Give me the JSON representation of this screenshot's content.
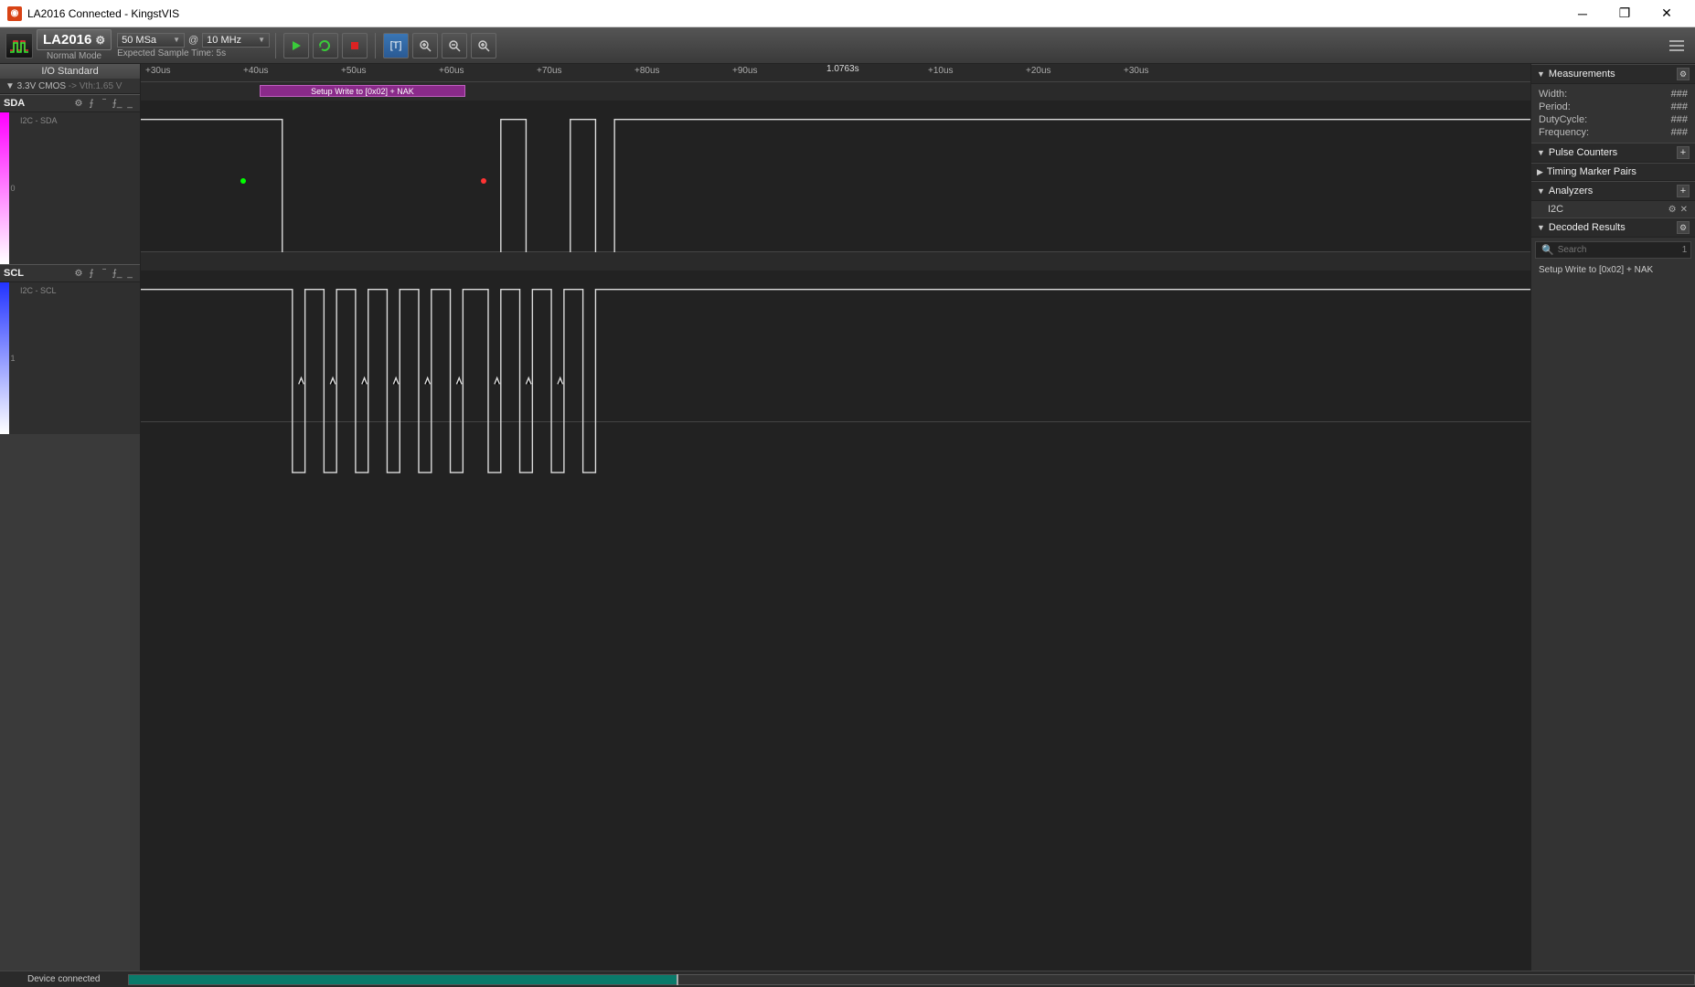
{
  "window": {
    "title": "LA2016 Connected - KingstVIS"
  },
  "toolbar": {
    "device": "LA2016",
    "mode": "Normal Mode",
    "sample_rate": "50 MSa",
    "at": "@",
    "clock": "10 MHz",
    "sample_hint": "Expected Sample Time: 5s"
  },
  "io": {
    "standard": "I/O Standard",
    "cmos": "▼ 3.3V CMOS",
    "vth": " -> Vth:1.65 V"
  },
  "channels": [
    {
      "name": "SDA",
      "sub": "I2C - SDA",
      "idx": "0"
    },
    {
      "name": "SCL",
      "sub": "I2C - SCL",
      "idx": "1"
    }
  ],
  "timeline": {
    "ticks": [
      "+30us",
      "+40us",
      "+50us",
      "+60us",
      "+70us",
      "+80us",
      "+90us",
      "+10us",
      "+20us",
      "+30us"
    ],
    "bigmark": "1.0763s"
  },
  "decode_overlay": "Setup Write to [0x02] + NAK",
  "panels": {
    "measurements": {
      "title": "Measurements",
      "rows": [
        {
          "k": "Width:",
          "v": "###"
        },
        {
          "k": "Period:",
          "v": "###"
        },
        {
          "k": "DutyCycle:",
          "v": "###"
        },
        {
          "k": "Frequency:",
          "v": "###"
        }
      ]
    },
    "pulse": "Pulse Counters",
    "timing": "Timing Marker Pairs",
    "analyzers": {
      "title": "Analyzers",
      "item": "I2C"
    },
    "decoded": {
      "title": "Decoded Results",
      "search_ph": "Search",
      "count": "1",
      "item": "Setup Write to [0x02] + NAK"
    }
  },
  "status": "Device connected"
}
